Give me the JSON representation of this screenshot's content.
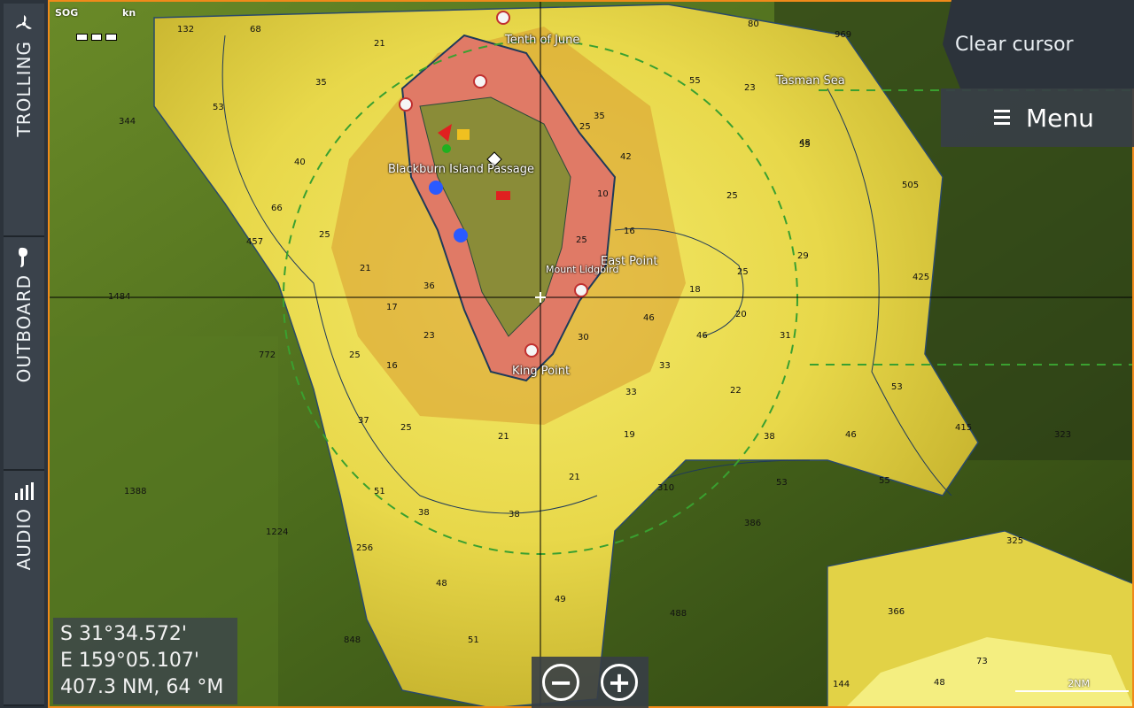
{
  "sidebar": {
    "tabs": [
      {
        "label": "TROLLING",
        "icon": "propeller-icon"
      },
      {
        "label": "OUTBOARD",
        "icon": "outboard-motor-icon"
      },
      {
        "label": "AUDIO",
        "icon": "audio-bars-icon"
      }
    ]
  },
  "header": {
    "sog_label": "SOG",
    "sog_unit": "kn"
  },
  "buttons": {
    "clear_cursor": "Clear cursor",
    "menu": "Menu"
  },
  "readout": {
    "lat": "S  31°34.572'",
    "lon": "E 159°05.107'",
    "range": "407.3 NM, 64 °M"
  },
  "zoom": {
    "out": "−",
    "in": "+"
  },
  "scale": {
    "label": "2NM"
  },
  "places": {
    "tenth_of_june": "Tenth of June",
    "tasman_sea": "Tasman Sea",
    "blackburn": "Blackburn Island Passage",
    "east_point": "East Point",
    "mount_lidgbird": "Mount Lidgbird",
    "king_point": "King Point"
  },
  "depths": [
    "132",
    "68",
    "80",
    "969",
    "35",
    "53",
    "344",
    "40",
    "66",
    "457",
    "25",
    "21",
    "1484",
    "17",
    "23",
    "772",
    "25",
    "16",
    "37",
    "1388",
    "25",
    "51",
    "1224",
    "256",
    "38",
    "48",
    "38",
    "21",
    "21",
    "848",
    "51",
    "49",
    "33",
    "19",
    "22",
    "310",
    "386",
    "25",
    "25",
    "29",
    "46",
    "31",
    "53",
    "46",
    "38",
    "53",
    "55",
    "55",
    "505",
    "425",
    "415",
    "323",
    "325",
    "366",
    "488",
    "73",
    "48",
    "144",
    "35",
    "25",
    "42",
    "10",
    "16",
    "18",
    "20",
    "46",
    "33",
    "25",
    "30",
    "36",
    "21",
    "23",
    "48",
    "55",
    "23"
  ],
  "colors": {
    "border": "#f08a1a",
    "shallow": "#e8d84a",
    "land": "#e07a66",
    "deep": "#2b3a1e"
  }
}
